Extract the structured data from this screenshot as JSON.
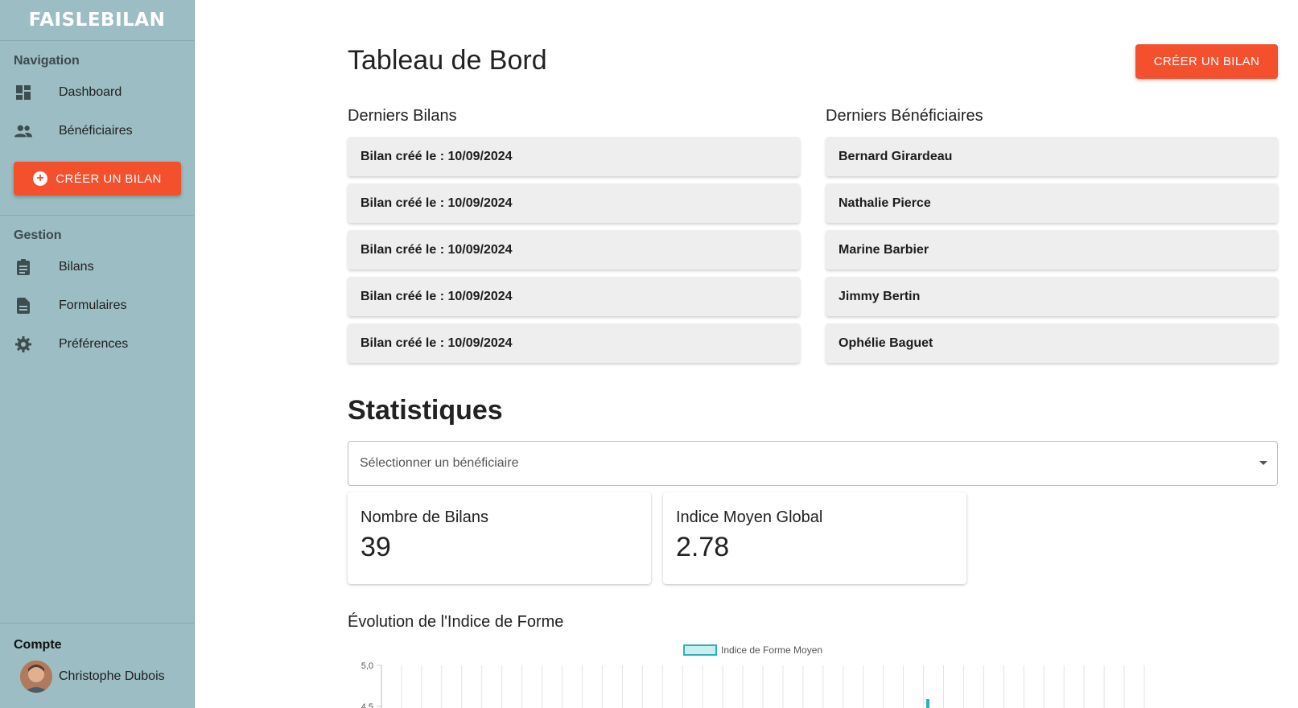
{
  "app": {
    "logo": "FAISLEBILAN"
  },
  "sidebar": {
    "navigation_title": "Navigation",
    "nav_items": [
      {
        "label": "Dashboard",
        "icon": "dashboard-icon"
      },
      {
        "label": "Bénéficiaires",
        "icon": "people-icon"
      }
    ],
    "cta_label": "CRÉER UN BILAN",
    "gestion_title": "Gestion",
    "gestion_items": [
      {
        "label": "Bilans",
        "icon": "clipboard-icon"
      },
      {
        "label": "Formulaires",
        "icon": "document-icon"
      },
      {
        "label": "Préférences",
        "icon": "gear-icon"
      }
    ],
    "account_title": "Compte",
    "user_name": "Christophe Dubois"
  },
  "main": {
    "title": "Tableau de Bord",
    "cta_label": "CRÉER UN BILAN",
    "bilans_title": "Derniers Bilans",
    "bilans": [
      "Bilan créé le : 10/09/2024",
      "Bilan créé le : 10/09/2024",
      "Bilan créé le : 10/09/2024",
      "Bilan créé le : 10/09/2024",
      "Bilan créé le : 10/09/2024"
    ],
    "beneficiaires_title": "Derniers Bénéficiaires",
    "beneficiaires": [
      "Bernard Girardeau",
      "Nathalie Pierce",
      "Marine Barbier",
      "Jimmy Bertin",
      "Ophélie Baguet"
    ],
    "stats_title": "Statistiques",
    "select_placeholder": "Sélectionner un bénéficiaire",
    "stat_cards": [
      {
        "label": "Nombre de Bilans",
        "value": "39"
      },
      {
        "label": "Indice Moyen Global",
        "value": "2.78"
      }
    ],
    "chart_title": "Évolution de l'Indice de Forme"
  },
  "colors": {
    "sidebar_bg": "#9bbdc3",
    "accent": "#f4502e",
    "series": "#2bb3b3"
  },
  "chart_data": {
    "type": "line",
    "series": [
      {
        "name": "Indice de Forme Moyen",
        "values": []
      }
    ],
    "y_ticks": [
      "5,0",
      "4,5"
    ],
    "legend": "top-center",
    "grid": true
  }
}
